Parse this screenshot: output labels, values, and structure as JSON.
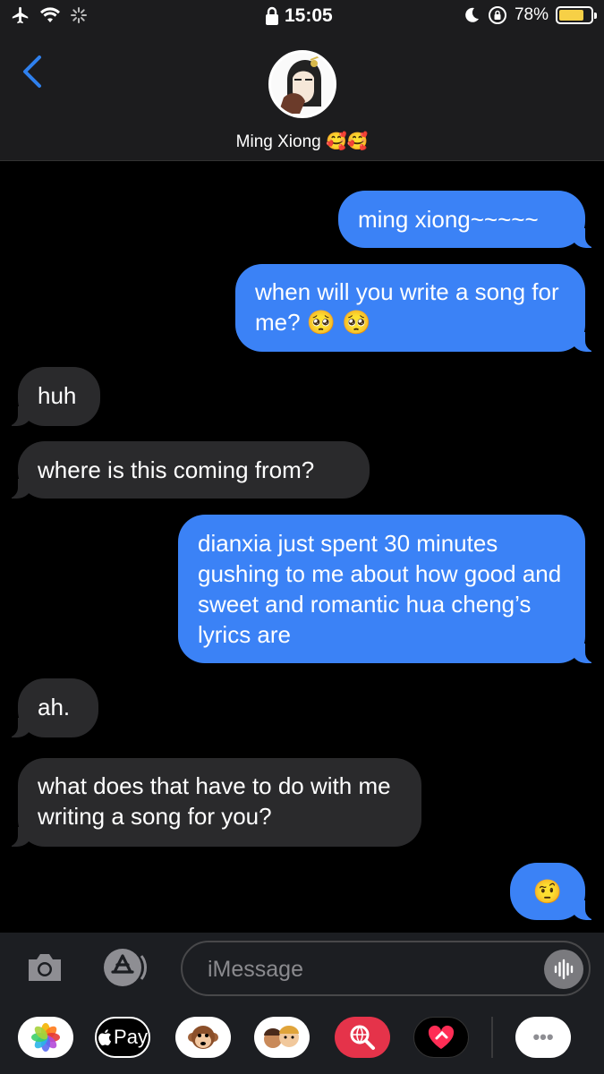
{
  "status_bar": {
    "time": "15:05",
    "battery_percent": "78%",
    "battery_level": 0.78,
    "icons": [
      "airplane-icon",
      "wifi-icon",
      "activity-spinner-icon",
      "lock-icon",
      "moon-icon",
      "rotation-lock-icon",
      "battery-icon"
    ]
  },
  "header": {
    "contact_name": "Ming Xiong 🥰🥰",
    "back_icon": "chevron-left-icon"
  },
  "messages": [
    {
      "direction": "outgoing",
      "text": "ming xiong~~~~~"
    },
    {
      "direction": "outgoing",
      "text": "when will you write a song for me? 🥺 🥺"
    },
    {
      "direction": "incoming",
      "text": "huh"
    },
    {
      "direction": "incoming",
      "text": "where is this coming from?"
    },
    {
      "direction": "outgoing",
      "text": "dianxia just spent 30 minutes gushing to me about how good and sweet and romantic hua cheng’s lyrics are"
    },
    {
      "direction": "incoming",
      "text": "ah."
    },
    {
      "direction": "incoming",
      "text": "what does that have to do with me writing a song for you?"
    },
    {
      "direction": "outgoing",
      "text": "🤨"
    }
  ],
  "input": {
    "placeholder": "iMessage",
    "icons": [
      "camera-icon",
      "app-store-icon",
      "audio-waveform-icon"
    ]
  },
  "app_drawer": {
    "apple_pay_label": "Pay",
    "more_label": "•••",
    "apps": [
      "photos-icon",
      "apple-pay-icon",
      "animoji-icon",
      "memoji-icon",
      "web-search-icon",
      "digital-touch-icon",
      "more-apps-icon"
    ]
  },
  "colors": {
    "outgoing_bubble": "#3b82f6",
    "incoming_bubble": "#2a2a2c",
    "accent": "#2f80ed",
    "battery": "#f7d046"
  }
}
